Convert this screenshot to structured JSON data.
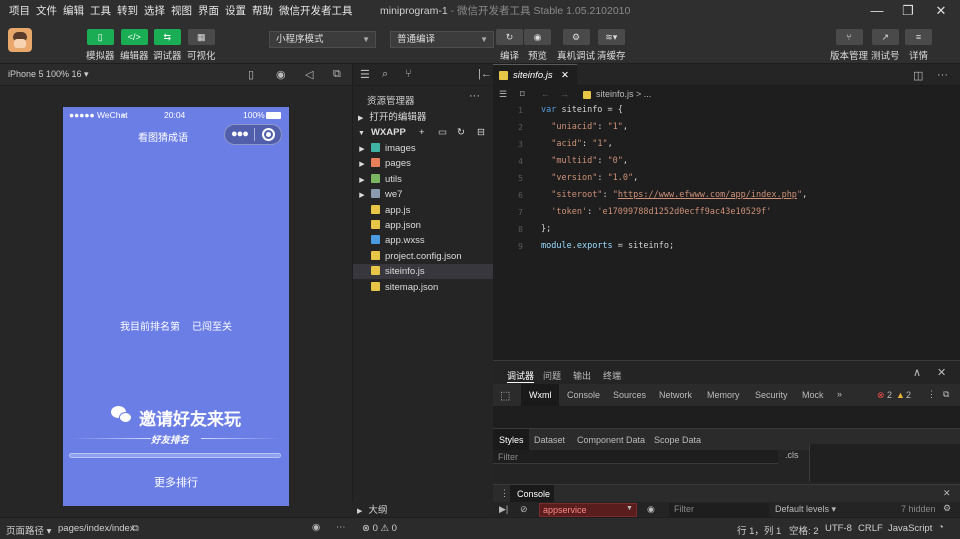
{
  "menubar": {
    "items": [
      "项目",
      "文件",
      "编辑",
      "工具",
      "转到",
      "选择",
      "视图",
      "界面",
      "设置",
      "帮助",
      "微信开发者工具"
    ],
    "title_project": "miniprogram-1",
    "title_app": "- 微信开发者工具 Stable 1.05.2102010"
  },
  "toolbar": {
    "simulator": "模拟器",
    "editor": "编辑器",
    "debugger": "调试器",
    "visual": "可视化",
    "mode_select": "小程序模式",
    "compile_select": "普通编译",
    "compile": "编译",
    "preview": "预览",
    "real_debug": "真机调试",
    "clear_cache": "清缓存",
    "version_mgmt": "版本管理",
    "test_account": "测试号",
    "details": "详情"
  },
  "simulator": {
    "device": "iPhone 5 100% 16 ▾",
    "status_carrier": "●●●●● WeChat",
    "status_time": "20:04",
    "status_battery": "100%",
    "nav_title": "看图猜成语",
    "rank_text": "我目前排名第",
    "passed_text": "已闯至关",
    "invite_text": "邀请好友来玩",
    "friend_rank": "好友排名",
    "more_rank": "更多排行"
  },
  "sim_footer": {
    "path_label": "页面路径 ▾",
    "path_value": "pages/index/index"
  },
  "explorer": {
    "title": "资源管理器",
    "open_editors": "打开的编辑器",
    "root": "WXAPP",
    "items": [
      {
        "name": "images",
        "type": "folder",
        "color": "#3fb3a6"
      },
      {
        "name": "pages",
        "type": "folder",
        "color": "#e8805a"
      },
      {
        "name": "utils",
        "type": "folder",
        "color": "#7bb661"
      },
      {
        "name": "we7",
        "type": "folder",
        "color": "#8a9bb0"
      },
      {
        "name": "app.js",
        "type": "js",
        "color": "#e7c547"
      },
      {
        "name": "app.json",
        "type": "json",
        "color": "#e7c547"
      },
      {
        "name": "app.wxss",
        "type": "wxss",
        "color": "#4a9be0"
      },
      {
        "name": "project.config.json",
        "type": "json",
        "color": "#e7c547"
      },
      {
        "name": "siteinfo.js",
        "type": "js",
        "color": "#e7c547"
      },
      {
        "name": "sitemap.json",
        "type": "json",
        "color": "#e7c547"
      }
    ],
    "outline": "大纲",
    "problems": "⊗ 0 ⚠ 0"
  },
  "editor": {
    "tab_label": "siteinfo.js",
    "breadcrumb": "siteinfo.js > ...",
    "lines": [
      {
        "n": "1",
        "t": "var siteinfo = {"
      },
      {
        "n": "2",
        "t": "  \"uniacid\": \"1\","
      },
      {
        "n": "3",
        "t": "  \"acid\": \"1\","
      },
      {
        "n": "4",
        "t": "  \"multiid\": \"0\","
      },
      {
        "n": "5",
        "t": "  \"version\": \"1.0\","
      },
      {
        "n": "6",
        "t": "  \"siteroot\": \"https://www.efwww.com/app/index.php\","
      },
      {
        "n": "7",
        "t": "  'token': 'e17099788d1252d0ecff9ac43e10529f'"
      },
      {
        "n": "8",
        "t": "};"
      },
      {
        "n": "9",
        "t": "module.exports = siteinfo;"
      }
    ]
  },
  "devtools": {
    "top_tabs": [
      "调试器",
      "问题",
      "输出",
      "终端"
    ],
    "panels": [
      "Wxml",
      "Console",
      "Sources",
      "Network",
      "Memory",
      "Security",
      "Mock"
    ],
    "errors": "2",
    "warnings": "2",
    "style_tabs": [
      "Styles",
      "Dataset",
      "Component Data",
      "Scope Data"
    ],
    "filter_placeholder": "Filter",
    "cls": ".cls",
    "console_tab": "Console",
    "context": "appservice",
    "console_filter": "Filter",
    "levels": "Default levels ▾",
    "hidden": "7 hidden"
  },
  "statusline": {
    "position": "行 1，列 1",
    "spaces": "空格: 2",
    "encoding": "UTF-8",
    "eol": "CRLF",
    "language": "JavaScript"
  }
}
